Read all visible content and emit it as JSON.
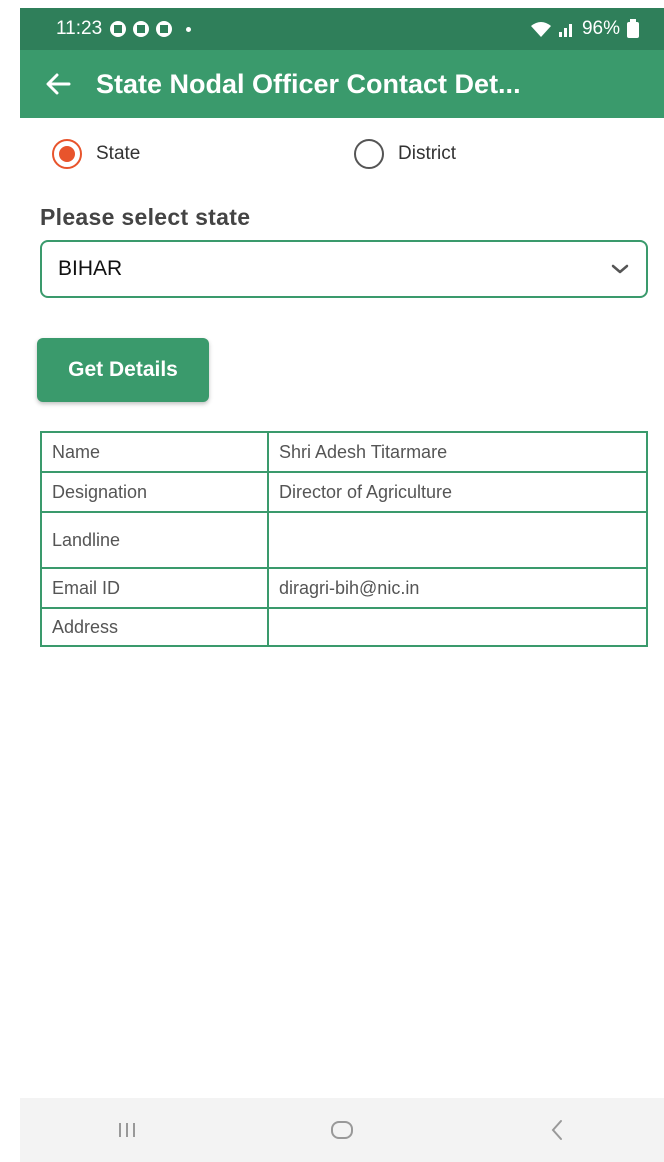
{
  "status": {
    "time": "11:23",
    "battery": "96%"
  },
  "app_bar": {
    "title": "State Nodal Officer Contact Det..."
  },
  "radios": {
    "state_label": "State",
    "district_label": "District",
    "selected": "State"
  },
  "select": {
    "label": "Please select state",
    "value": "BIHAR"
  },
  "button": {
    "label": "Get Details"
  },
  "details": {
    "rows": [
      {
        "key": "Name",
        "value": "Shri Adesh Titarmare"
      },
      {
        "key": "Designation",
        "value": "Director of Agriculture"
      },
      {
        "key": "Landline",
        "value": ""
      },
      {
        "key": "Email ID",
        "value": "diragri-bih@nic.in"
      },
      {
        "key": "Address",
        "value": ""
      }
    ]
  },
  "colors": {
    "accent": "#3a9a6c",
    "status_bar": "#2f7f5a",
    "radio_selected": "#e8542c"
  }
}
